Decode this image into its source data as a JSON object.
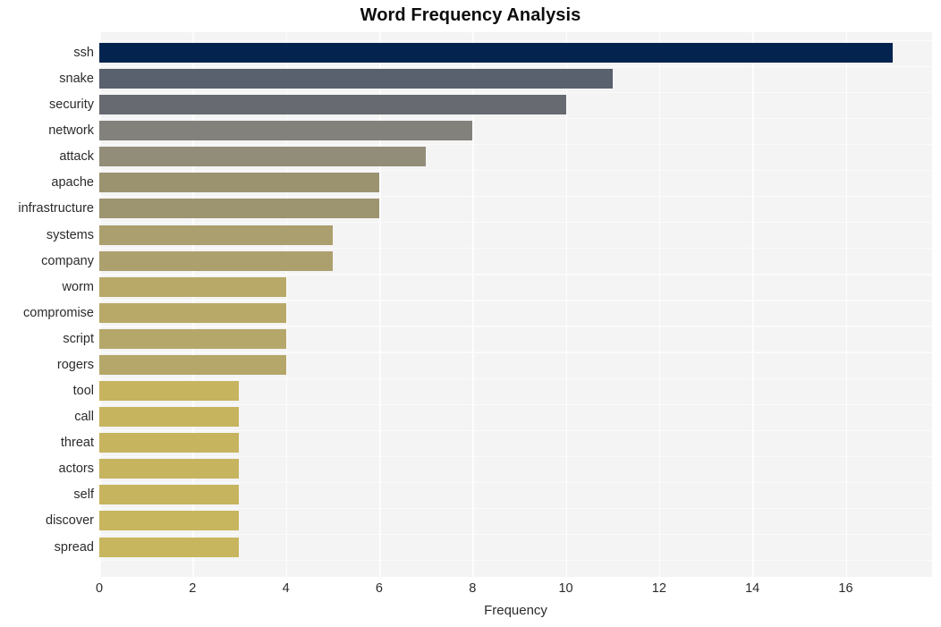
{
  "chart_data": {
    "type": "bar",
    "orientation": "horizontal",
    "title": "Word Frequency Analysis",
    "xlabel": "Frequency",
    "ylabel": "",
    "categories": [
      "ssh",
      "snake",
      "security",
      "network",
      "attack",
      "apache",
      "infrastructure",
      "systems",
      "company",
      "worm",
      "compromise",
      "script",
      "rogers",
      "tool",
      "call",
      "threat",
      "actors",
      "self",
      "discover",
      "spread"
    ],
    "values": [
      17,
      11,
      10,
      8,
      7,
      6,
      6,
      5,
      5,
      4,
      4,
      4,
      4,
      3,
      3,
      3,
      3,
      3,
      3,
      3
    ],
    "bar_colors": [
      "#04244f",
      "#59606e",
      "#686a72",
      "#83817c",
      "#928d79",
      "#9b9270",
      "#9d9470",
      "#ab9f6f",
      "#ad a0 6f",
      "#b8a968",
      "#b8a968",
      "#b5a76a",
      "#b5a76a",
      "#c6b45f",
      "#c6b45f",
      "#c6b45f",
      "#c6b45f",
      "#c6b45f",
      "#c8b65e",
      "#c8b65e"
    ],
    "xlim": [
      0,
      17.85
    ],
    "x_ticks": [
      "0",
      "2",
      "4",
      "6",
      "8",
      "10",
      "12",
      "14",
      "16"
    ],
    "x_tick_values": [
      0,
      2,
      4,
      6,
      8,
      10,
      12,
      14,
      16
    ],
    "grid": true,
    "grid_axis": "both",
    "legend": false,
    "plot_background": "#f4f4f5",
    "figure_background": "#ffffff",
    "title_color": "#0c0c0c",
    "tick_color": "#2b2b2b"
  }
}
